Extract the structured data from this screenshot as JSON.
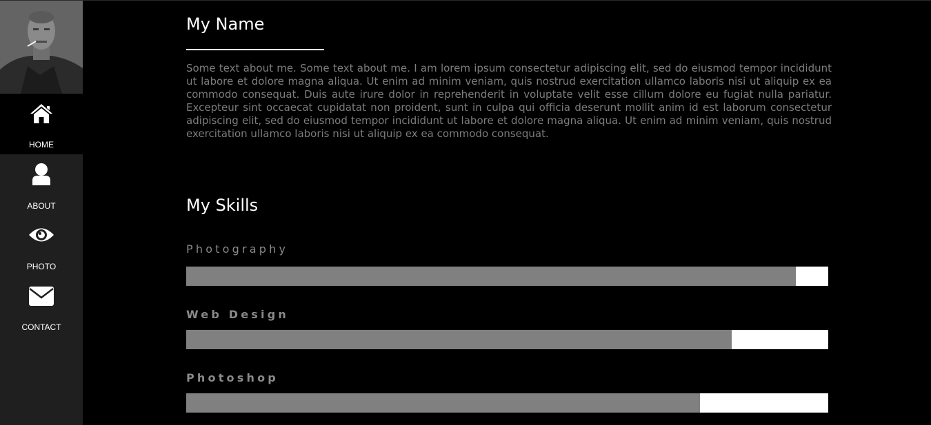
{
  "sidebar": {
    "items": [
      {
        "label": "HOME",
        "icon": "home-icon",
        "active": true
      },
      {
        "label": "ABOUT",
        "icon": "user-icon",
        "active": false
      },
      {
        "label": "PHOTO",
        "icon": "eye-icon",
        "active": false
      },
      {
        "label": "CONTACT",
        "icon": "envelope-icon",
        "active": false
      }
    ]
  },
  "main": {
    "name_title": "My Name",
    "about_text": "Some text about me. Some text about me. I am lorem ipsum consectetur adipiscing elit, sed do eiusmod tempor incididunt ut labore et dolore magna aliqua. Ut enim ad minim veniam, quis nostrud exercitation ullamco laboris nisi ut aliquip ex ea commodo consequat. Duis aute irure dolor in reprehenderit in voluptate velit esse cillum dolore eu fugiat nulla pariatur. Excepteur sint occaecat cupidatat non proident, sunt in culpa qui officia deserunt mollit anim id est laborum consectetur adipiscing elit, sed do eiusmod tempor incididunt ut labore et dolore magna aliqua. Ut enim ad minim veniam, quis nostrud exercitation ullamco laboris nisi ut aliquip ex ea commodo consequat.",
    "skills_title": "My Skills",
    "skills": [
      {
        "name": "Photography",
        "level": 0.95
      },
      {
        "name": "Web Design",
        "level": 0.85
      },
      {
        "name": "Photoshop",
        "level": 0.8
      }
    ]
  },
  "colors": {
    "background": "#000000",
    "sidebar": "#1f1f1f",
    "bar_fill": "#808080",
    "bar_track": "#ffffff",
    "muted_text": "#7d7d7d"
  }
}
